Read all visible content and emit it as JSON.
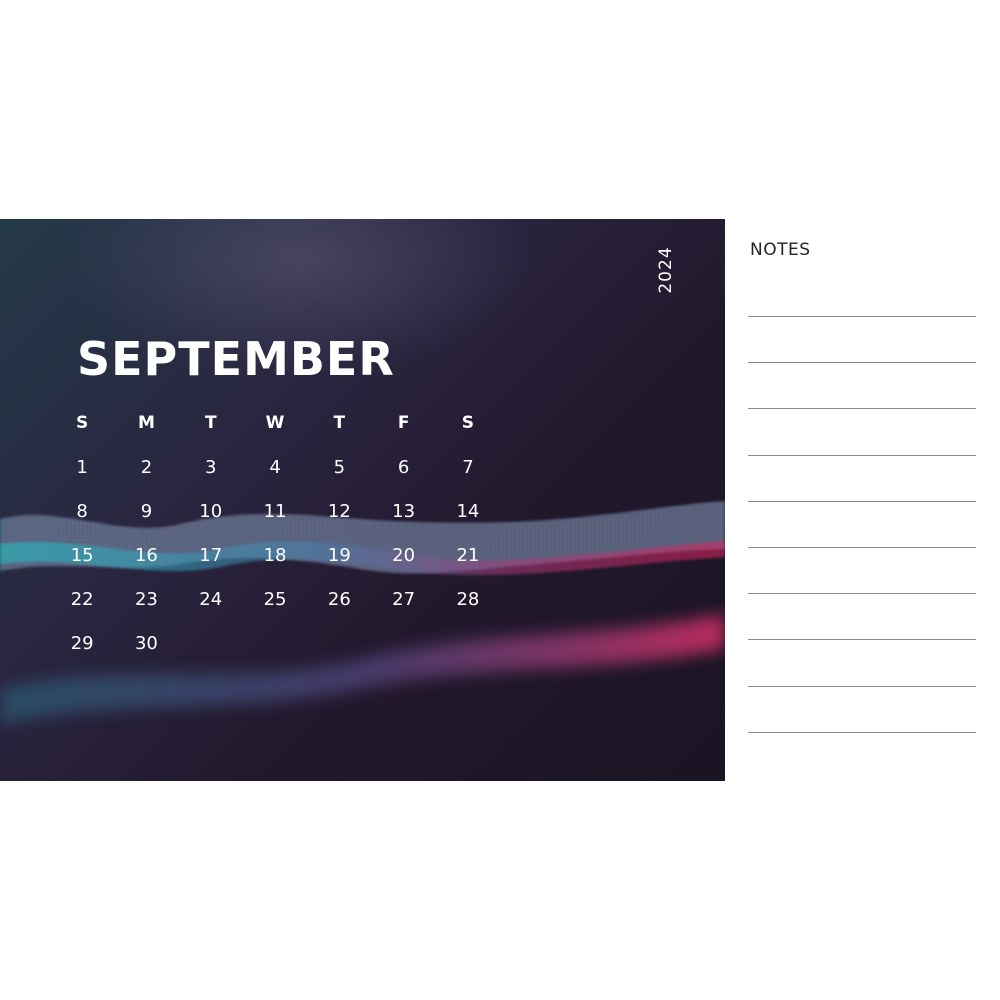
{
  "calendar": {
    "month": "SEPTEMBER",
    "year": "2024",
    "weekdays": [
      "S",
      "M",
      "T",
      "W",
      "T",
      "F",
      "S"
    ],
    "leading_blanks": 0,
    "days": [
      "1",
      "2",
      "3",
      "4",
      "5",
      "6",
      "7",
      "8",
      "9",
      "10",
      "11",
      "12",
      "13",
      "14",
      "15",
      "16",
      "17",
      "18",
      "19",
      "20",
      "21",
      "22",
      "23",
      "24",
      "25",
      "26",
      "27",
      "28",
      "29",
      "30"
    ]
  },
  "notes": {
    "title": "NOTES",
    "line_count": 10
  },
  "colors": {
    "background_dark": "#1f1828",
    "wave_teal": "#1fc6c6",
    "wave_magenta": "#e0245e",
    "text_light": "#ffffff"
  }
}
